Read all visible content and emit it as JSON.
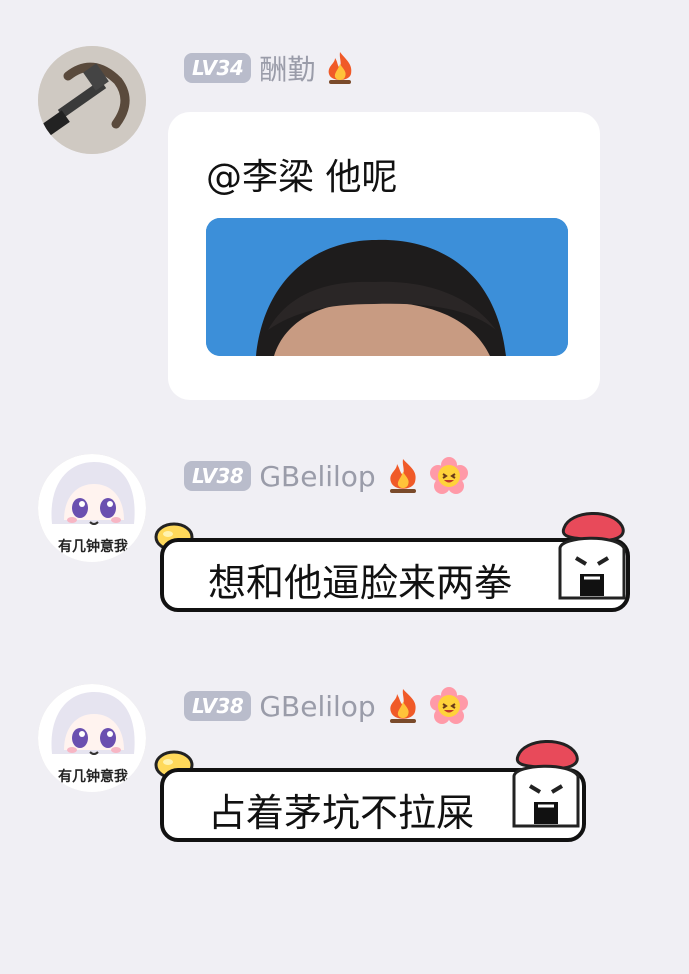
{
  "messages": [
    {
      "level": "LV34",
      "username": "酬勤",
      "badges": [
        "fire-icon"
      ],
      "text": "@李梁 他呢"
    },
    {
      "level": "LV38",
      "username": "GBelilop",
      "badges": [
        "fire-icon",
        "smiley-flower-icon"
      ],
      "avatar_caption": "有几钟意我",
      "text": "想和他逼脸来两拳"
    },
    {
      "level": "LV38",
      "username": "GBelilop",
      "badges": [
        "fire-icon",
        "smiley-flower-icon"
      ],
      "avatar_caption": "有几钟意我",
      "text": "占着茅坑不拉屎"
    }
  ],
  "colors": {
    "background": "#f0eff4",
    "level_badge": "#b9bccb",
    "username": "#9a9ca9",
    "photo_sky": "#3c8fd9"
  }
}
